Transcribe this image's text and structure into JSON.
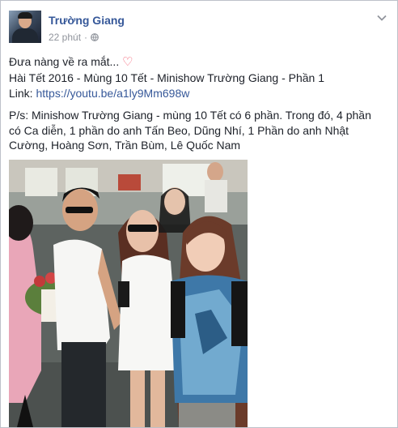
{
  "post": {
    "author": "Trường Giang",
    "time": "22 phút",
    "dot": "·",
    "line1": "Đưa nàng về ra mắt...",
    "heart": "♡",
    "line2": "Hài Tết 2016 - Mùng 10 Tết - Minishow Trường Giang - Phần 1",
    "link_label": "Link:",
    "link_url": "https://youtu.be/a1ly9Mm698w",
    "ps1": "P/s: Minishow Trường Giang - mùng 10 Tết có 6 phần. Trong đó, 4 phần",
    "ps2": "có Ca diễn, 1 phần do anh Tấn Beo, Dũng Nhí, 1 Phần do anh Nhật",
    "ps3": "Cường, Hoàng Sơn, Trần Bùm, Lê Quốc Nam"
  },
  "icons": {
    "privacy": "globe-icon",
    "menu": "chevron-down-icon"
  },
  "colors": {
    "author": "#365899",
    "meta": "#90949c",
    "heart": "#f25268",
    "border": "#bdc1c9"
  }
}
